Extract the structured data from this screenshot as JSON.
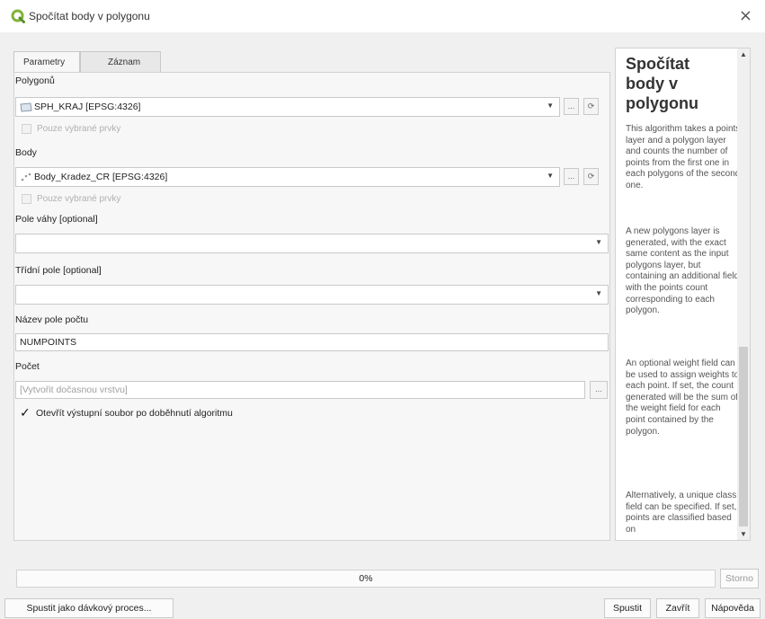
{
  "window": {
    "title": "Spočítat body v polygonu",
    "close_glyph": "×"
  },
  "tabs": [
    {
      "label": "Parametry"
    },
    {
      "label": "Záznam"
    }
  ],
  "fields": {
    "polygons": {
      "label": "Polygonů",
      "value": "SPH_KRAJ [EPSG:4326]",
      "selected_only": "Pouze vybrané prvky"
    },
    "points": {
      "label": "Body",
      "value": "Body_Kradez_CR [EPSG:4326]",
      "selected_only": "Pouze vybrané prvky"
    },
    "weight": {
      "label": "Pole váhy [optional]",
      "value": ""
    },
    "class_field": {
      "label": "Třídní pole [optional]",
      "value": ""
    },
    "count_field_name": {
      "label": "Název pole počtu",
      "value": "NUMPOINTS"
    },
    "count": {
      "label": "Počet",
      "placeholder": "[Vytvořit dočasnou vrstvu]"
    },
    "open_output": {
      "label": "Otevřít výstupní soubor po doběhnutí algoritmu",
      "checked": true
    }
  },
  "buttons": {
    "ellipsis": "...",
    "iterate": "⟳"
  },
  "help": {
    "title": "Spočítat body v polygonu",
    "paragraphs": [
      "This algorithm takes a points layer and a polygon layer and counts the number of points from the first one in each polygons of the second one.",
      "A new polygons layer is generated, with the exact same content as the input polygons layer, but containing an additional field with the points count corresponding to each polygon.",
      "An optional weight field can be used to assign weights to each point. If set, the count generated will be the sum of the weight field for each point contained by the polygon.",
      "Alternatively, a unique class field can be specified. If set, points are classified based on"
    ]
  },
  "progress": {
    "value": 0,
    "text": "0%"
  },
  "footer": {
    "cancel": "Storno",
    "batch": "Spustit jako dávkový proces...",
    "run": "Spustit",
    "close": "Zavřít",
    "help": "Nápověda"
  },
  "colors": {
    "qgis_green": "#7fb33a",
    "window_bg": "#f0f0f0"
  }
}
